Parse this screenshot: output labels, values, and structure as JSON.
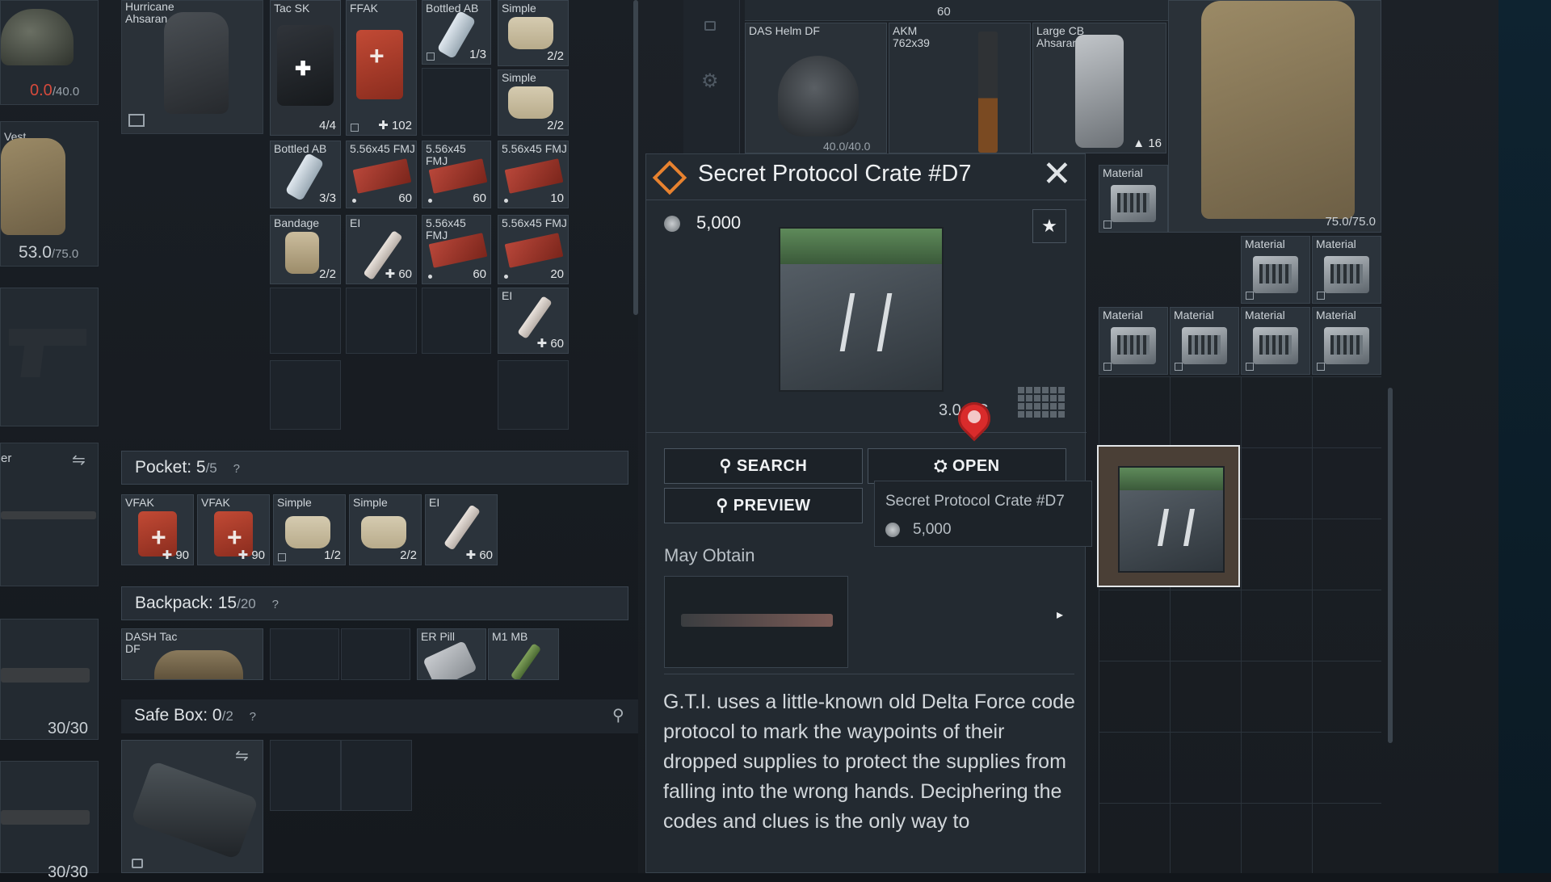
{
  "left_equipment": {
    "helmet_durability": "0.0",
    "helmet_durability_max": "/40.0",
    "vest_label": "Vest",
    "vest_durability": "53.0",
    "vest_durability_max": "/75.0",
    "weapon_label": "er",
    "weapon1_ammo": "30/30",
    "weapon2_ammo": "30/30"
  },
  "chest_rig": {
    "name": "Hurricane Ahsaran"
  },
  "rig_items": [
    {
      "label": "Tac SK",
      "count": "4/4"
    },
    {
      "label": "FFAK",
      "count": "102"
    },
    {
      "label": "Bottled AB",
      "count": "1/3"
    },
    {
      "label": "Simple",
      "count": "2/2"
    },
    {
      "label": "Simple",
      "count": "2/2"
    },
    {
      "label": "Bottled AB",
      "count": "3/3"
    },
    {
      "label": "5.56x45 FMJ",
      "count": "60"
    },
    {
      "label": "5.56x45 FMJ",
      "count": "60"
    },
    {
      "label": "5.56x45 FMJ",
      "count": "10"
    },
    {
      "label": "Bandage",
      "count": "2/2"
    },
    {
      "label": "EI",
      "count": "60"
    },
    {
      "label": "5.56x45 FMJ",
      "count": "60"
    },
    {
      "label": "5.56x45 FMJ",
      "count": "20"
    },
    {
      "label": "EI",
      "count": "60"
    }
  ],
  "pocket": {
    "label": "Pocket:",
    "used": "5",
    "capacity": "/5",
    "help": "?",
    "items": [
      {
        "label": "VFAK",
        "count": "90"
      },
      {
        "label": "VFAK",
        "count": "90"
      },
      {
        "label": "Simple",
        "count": "1/2"
      },
      {
        "label": "Simple",
        "count": "2/2"
      },
      {
        "label": "EI",
        "count": "60"
      }
    ]
  },
  "backpack": {
    "label": "Backpack:",
    "used": "15",
    "capacity": "/20",
    "help": "?",
    "name": "DASH Tac DF",
    "items": [
      {
        "label": "ER Pill"
      },
      {
        "label": "M1 MB"
      }
    ]
  },
  "safe_box": {
    "label": "Safe Box:",
    "used": "0",
    "capacity": "/2",
    "help": "?"
  },
  "stash": {
    "top_count": "60",
    "helmet_name": "DAS Helm DF",
    "helmet_durability": "40.0/40.0",
    "akm_label": "AKM 762x39",
    "large_cb_label": "Large CB Ahsaran",
    "large_cb_count": "16",
    "vest_durability": "75.0/75.0",
    "material_label": "Material"
  },
  "popup": {
    "title": "Secret Protocol Crate #D7",
    "price": "5,000",
    "weight": "3.0 KG",
    "search_label": "SEARCH",
    "open_label": "OPEN",
    "preview_label": "PREVIEW",
    "may_obtain_label": "May Obtain",
    "description": "G.T.I. uses a little-known old Delta Force code protocol to mark the waypoints of their dropped supplies to protect the supplies from falling into the wrong hands. Deciphering the codes and clues is the only way to"
  },
  "tooltip": {
    "name": "Secret Protocol Crate #D7",
    "price": "5,000"
  },
  "colors": {
    "accent_orange": "#e8822f",
    "marker_red": "#d92b2b",
    "crate_green": "#5e8a5a"
  }
}
